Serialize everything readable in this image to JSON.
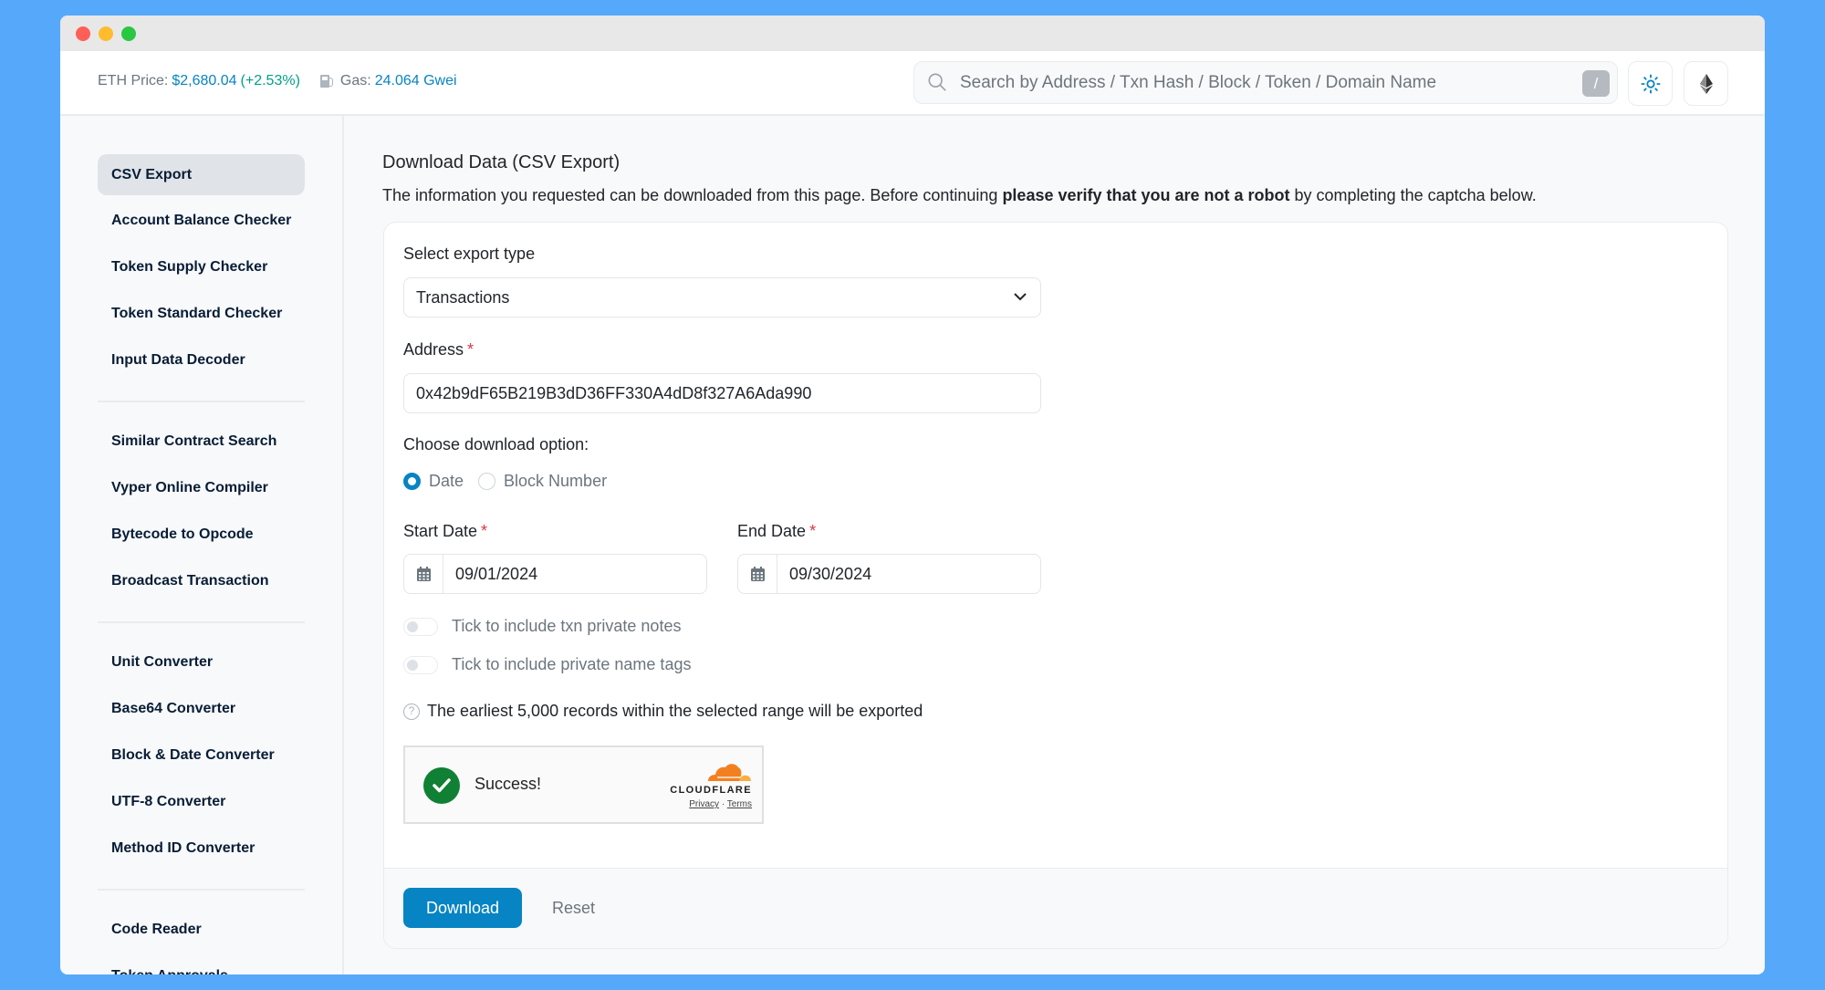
{
  "window": {
    "controls": [
      "close",
      "minimize",
      "maximize"
    ]
  },
  "header": {
    "eth_price_label": "ETH Price:",
    "eth_price_value": "$2,680.04",
    "eth_price_change": "(+2.53%)",
    "gas_label": "Gas:",
    "gas_value": "24.064 Gwei",
    "search_placeholder": "Search by Address / Txn Hash / Block / Token / Domain Name",
    "search_shortcut": "/",
    "icons": {
      "gas": "gas-pump-icon",
      "search": "search-icon",
      "theme": "sun-icon",
      "network": "ethereum-icon"
    },
    "colors": {
      "link_blue": "#0784c3",
      "positive_green": "#00a186"
    }
  },
  "sidebar": {
    "groups": [
      {
        "items": [
          {
            "label": "CSV Export",
            "active": true
          },
          {
            "label": "Account Balance Checker",
            "active": false
          },
          {
            "label": "Token Supply Checker",
            "active": false
          },
          {
            "label": "Token Standard Checker",
            "active": false
          },
          {
            "label": "Input Data Decoder",
            "active": false
          }
        ]
      },
      {
        "items": [
          {
            "label": "Similar Contract Search",
            "active": false
          },
          {
            "label": "Vyper Online Compiler",
            "active": false
          },
          {
            "label": "Bytecode to Opcode",
            "active": false
          },
          {
            "label": "Broadcast Transaction",
            "active": false
          }
        ]
      },
      {
        "items": [
          {
            "label": "Unit Converter",
            "active": false
          },
          {
            "label": "Base64 Converter",
            "active": false
          },
          {
            "label": "Block & Date Converter",
            "active": false
          },
          {
            "label": "UTF-8 Converter",
            "active": false
          },
          {
            "label": "Method ID Converter",
            "active": false
          }
        ]
      },
      {
        "items": [
          {
            "label": "Code Reader",
            "active": false
          },
          {
            "label": "Token Approvals",
            "active": false
          }
        ]
      }
    ]
  },
  "main": {
    "title": "Download Data (CSV Export)",
    "description_prefix": "The information you requested can be downloaded from this page. Before continuing ",
    "description_bold": "please verify that you are not a robot",
    "description_suffix": " by completing the captcha below.",
    "form": {
      "export_type_label": "Select export type",
      "export_type_value": "Transactions",
      "address_label": "Address",
      "address_value": "0x42b9dF65B219B3dD36FF330A4dD8f327A6Ada990",
      "required_mark": "*",
      "download_option_label": "Choose download option:",
      "options": [
        {
          "label": "Date",
          "checked": true
        },
        {
          "label": "Block Number",
          "checked": false
        }
      ],
      "start_date_label": "Start Date",
      "start_date_value": "09/01/2024",
      "end_date_label": "End Date",
      "end_date_value": "09/30/2024",
      "toggles": [
        {
          "label": "Tick to include txn private notes",
          "on": false,
          "disabled": true
        },
        {
          "label": "Tick to include private name tags",
          "on": false,
          "disabled": true
        }
      ],
      "info_text": "The earliest 5,000 records within the selected range will be exported"
    },
    "captcha": {
      "status": "Success!",
      "provider": "CLOUDFLARE",
      "privacy_link": "Privacy",
      "separator": "·",
      "terms_link": "Terms",
      "colors": {
        "check": "#0f8034",
        "cloud_dark": "#f38020",
        "cloud_light": "#faae40"
      }
    },
    "actions": {
      "download_label": "Download",
      "reset_label": "Reset"
    }
  }
}
